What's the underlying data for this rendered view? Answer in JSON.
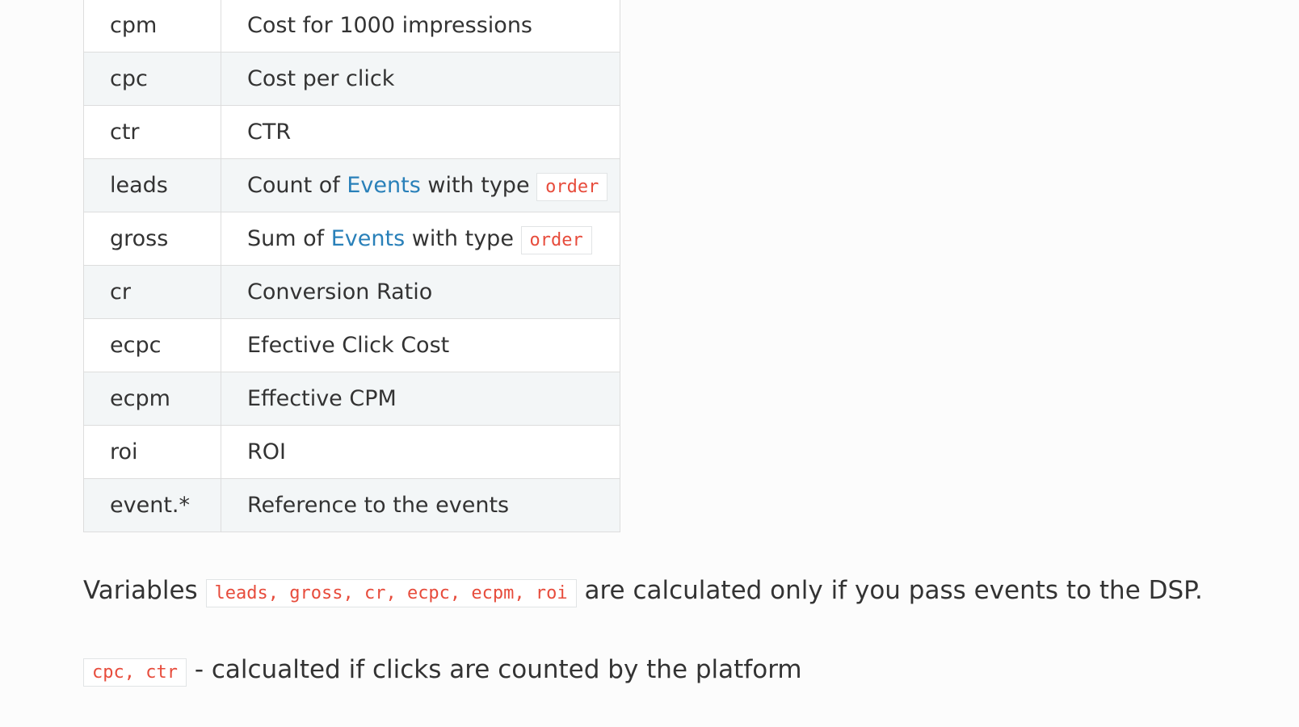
{
  "table": {
    "rows": [
      {
        "name": "cpm",
        "desc": "Cost for 1000 impressions"
      },
      {
        "name": "cpc",
        "desc": "Cost per click"
      },
      {
        "name": "ctr",
        "desc": "CTR"
      },
      {
        "name": "leads",
        "desc_before": "Count of ",
        "desc_link": "Events",
        "desc_after": " with type ",
        "desc_code": "order"
      },
      {
        "name": "gross",
        "desc_before": "Sum of ",
        "desc_link": "Events",
        "desc_after": " with type ",
        "desc_code": "order"
      },
      {
        "name": "cr",
        "desc": "Conversion Ratio"
      },
      {
        "name": "ecpc",
        "desc": "Efective Click Cost"
      },
      {
        "name": "ecpm",
        "desc": "Effective CPM"
      },
      {
        "name": "roi",
        "desc": "ROI"
      },
      {
        "name": "event.*",
        "desc": "Reference to the events"
      }
    ]
  },
  "notes": {
    "first": {
      "before": "Variables ",
      "code": "leads, gross, cr, ecpc, ecpm, roi",
      "after": " are calculated only if you pass events to the DSP."
    },
    "second": {
      "code": "cpc, ctr",
      "after": " - calcualted if clicks are counted by the platform"
    }
  },
  "colors": {
    "text": "#333333",
    "link": "#2980b9",
    "code": "#e74c3c",
    "row_alt": "#f3f6f7",
    "border": "#dddddd"
  }
}
